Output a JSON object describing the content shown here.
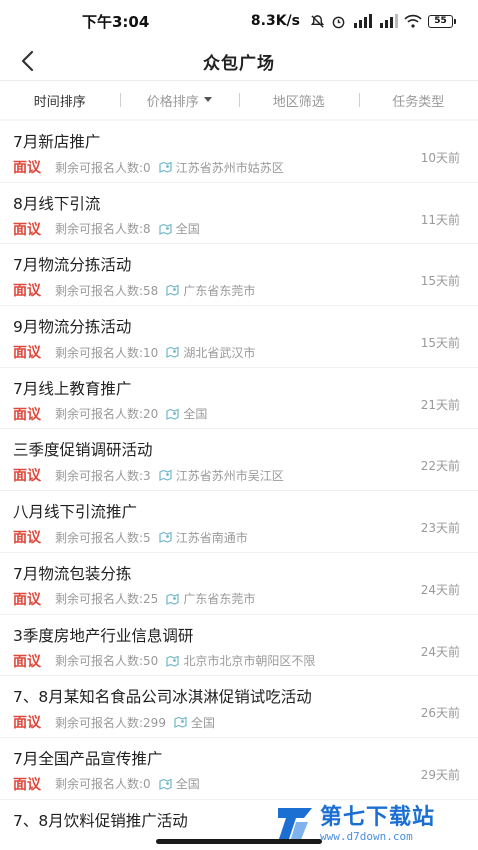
{
  "status_bar": {
    "time": "下午3:04",
    "speed": "8.3K/s",
    "battery": "55"
  },
  "nav": {
    "title": "众包广场"
  },
  "filters": [
    {
      "label": "时间排序",
      "active": true
    },
    {
      "label": "价格排序",
      "active": false
    },
    {
      "label": "地区筛选",
      "active": false
    },
    {
      "label": "任务类型",
      "active": false
    }
  ],
  "tasks": [
    {
      "title": "7月新店推广",
      "price": "面议",
      "slots": "剩余可报名人数:0",
      "location": "江苏省苏州市姑苏区",
      "days": "10天前"
    },
    {
      "title": "8月线下引流",
      "price": "面议",
      "slots": "剩余可报名人数:8",
      "location": "全国",
      "days": "11天前"
    },
    {
      "title": "7月物流分拣活动",
      "price": "面议",
      "slots": "剩余可报名人数:58",
      "location": "广东省东莞市",
      "days": "15天前"
    },
    {
      "title": "9月物流分拣活动",
      "price": "面议",
      "slots": "剩余可报名人数:10",
      "location": "湖北省武汉市",
      "days": "15天前"
    },
    {
      "title": "7月线上教育推广",
      "price": "面议",
      "slots": "剩余可报名人数:20",
      "location": "全国",
      "days": "21天前"
    },
    {
      "title": "三季度促销调研活动",
      "price": "面议",
      "slots": "剩余可报名人数:3",
      "location": "江苏省苏州市吴江区",
      "days": "22天前"
    },
    {
      "title": "八月线下引流推广",
      "price": "面议",
      "slots": "剩余可报名人数:5",
      "location": "江苏省南通市",
      "days": "23天前"
    },
    {
      "title": "7月物流包装分拣",
      "price": "面议",
      "slots": "剩余可报名人数:25",
      "location": "广东省东莞市",
      "days": "24天前"
    },
    {
      "title": "3季度房地产行业信息调研",
      "price": "面议",
      "slots": "剩余可报名人数:50",
      "location": "北京市北京市朝阳区不限",
      "days": "24天前"
    },
    {
      "title": "7、8月某知名食品公司冰淇淋促销试吃活动",
      "price": "面议",
      "slots": "剩余可报名人数:299",
      "location": "全国",
      "days": "26天前"
    },
    {
      "title": "7月全国产品宣传推广",
      "price": "面议",
      "slots": "剩余可报名人数:0",
      "location": "全国",
      "days": "29天前"
    },
    {
      "title": "7、8月饮料促销推广活动",
      "price": "",
      "slots": "",
      "location": "",
      "days": ""
    }
  ],
  "watermark": {
    "name": "第七下载站",
    "url": "www.d7down.com"
  },
  "colors": {
    "price": "#e0483b",
    "location_icon": "#6fb7c9",
    "watermark": "#1c6fd2"
  }
}
